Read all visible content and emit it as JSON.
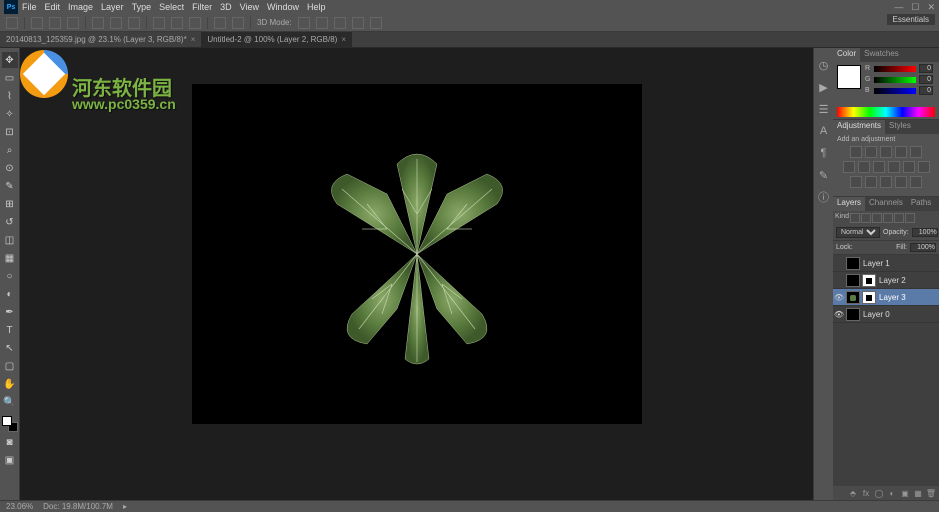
{
  "app": {
    "icon_label": "Ps",
    "menu": [
      "File",
      "Edit",
      "Image",
      "Layer",
      "Type",
      "Select",
      "Filter",
      "3D",
      "View",
      "Window",
      "Help"
    ],
    "win_ctrl": [
      "—",
      "☐",
      "✕"
    ],
    "workspace": "Essentials"
  },
  "options": {
    "3d_mode": "3D Mode:"
  },
  "tabs": [
    {
      "label": "20140813_125359.jpg @ 23.1% (Layer 3, RGB/8)*",
      "active": false
    },
    {
      "label": "Untitled-2 @ 100% (Layer 2, RGB/8)",
      "active": true
    }
  ],
  "watermark": {
    "text": "河东软件园",
    "url": "www.pc0359.cn"
  },
  "panels": {
    "color": {
      "tabs": [
        "Color",
        "Swatches"
      ],
      "sliders": [
        {
          "label": "R",
          "value": "0"
        },
        {
          "label": "G",
          "value": "0"
        },
        {
          "label": "B",
          "value": "0"
        }
      ]
    },
    "adjustments": {
      "tabs": [
        "Adjustments",
        "Styles"
      ],
      "header": "Add an adjustment"
    },
    "layers": {
      "tabs": [
        "Layers",
        "Channels",
        "Paths"
      ],
      "kind_label": "Kind",
      "blend_mode": "Normal",
      "opacity_label": "Opacity:",
      "opacity_value": "100%",
      "lock_label": "Lock:",
      "fill_label": "Fill:",
      "fill_value": "100%",
      "items": [
        {
          "visible": false,
          "name": "Layer 1",
          "selected": false,
          "mask": false
        },
        {
          "visible": false,
          "name": "Layer 2",
          "selected": false,
          "mask": true
        },
        {
          "visible": true,
          "name": "Layer 3",
          "selected": true,
          "mask": true
        },
        {
          "visible": true,
          "name": "Layer 0",
          "selected": false,
          "mask": false
        }
      ]
    }
  },
  "status": {
    "zoom": "23.06%",
    "doc_info": "Doc: 19.8M/100.7M"
  }
}
